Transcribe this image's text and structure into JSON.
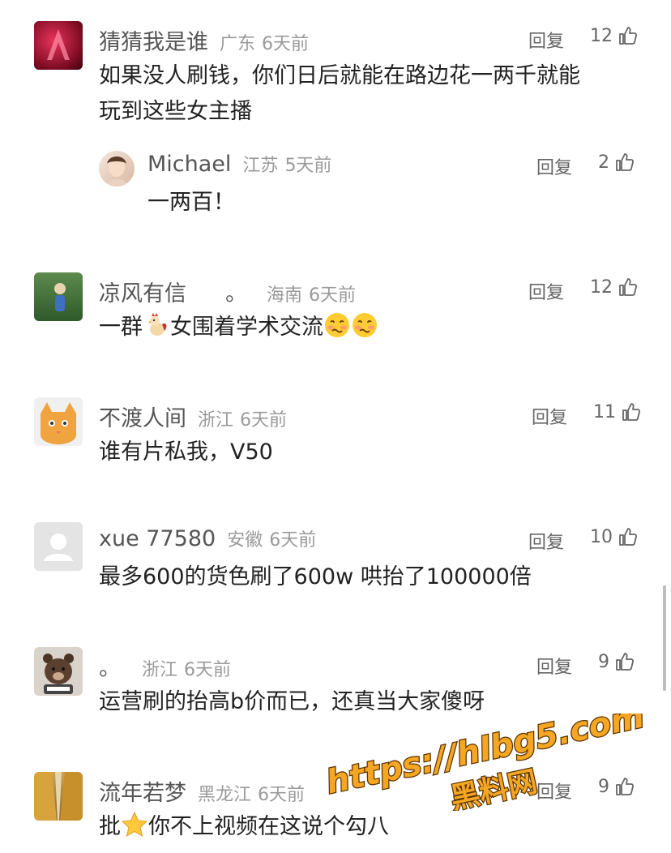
{
  "comments": [
    {
      "username": "猜猜我是谁",
      "location": "广东",
      "time": "6天前",
      "reply_label": "回复",
      "likes": "12",
      "text": [
        "如果没人刷钱，你们日后就能在路边花一两千就能",
        "玩到这些女主播"
      ]
    },
    {
      "username": "Michael",
      "location": "江苏",
      "time": "5天前",
      "reply_label": "回复",
      "likes": "2",
      "text": [
        "一两百！"
      ]
    },
    {
      "username": "凉风有信",
      "username_suffix": "。",
      "location": "海南",
      "time": "6天前",
      "reply_label": "回复",
      "likes": "12",
      "text_a": "一群",
      "text_b": "女围着学术交流"
    },
    {
      "username": "不渡人间",
      "location": "浙江",
      "time": "6天前",
      "reply_label": "回复",
      "likes": "11",
      "text": [
        "谁有片私我，V50"
      ]
    },
    {
      "username": "xue 77580",
      "location": "安徽",
      "time": "6天前",
      "reply_label": "回复",
      "likes": "10",
      "text": [
        "最多600的货色刷了600w 哄抬了100000倍"
      ]
    },
    {
      "username": "。",
      "location": "浙江",
      "time": "6天前",
      "reply_label": "回复",
      "likes": "9",
      "text": [
        "运营刷的抬高b价而已，还真当大家傻呀"
      ]
    },
    {
      "username": "流年若梦",
      "location": "黑龙江",
      "time": "6天前",
      "reply_label": "回复",
      "likes": "9",
      "text_a": "批",
      "text_b": "你不上视频在这说个勾八"
    }
  ],
  "icons": {
    "like": "thumbs-up-icon",
    "rooster": "rooster-emoji",
    "woozy": "woozy-face-emoji",
    "star": "star-emoji"
  },
  "watermark": {
    "url": "https://hlbg5.com",
    "name": "黑料网"
  },
  "colors": {
    "meta": "#9a9a9a",
    "username": "#555555",
    "text": "#222222",
    "watermark": "#f5a623"
  }
}
